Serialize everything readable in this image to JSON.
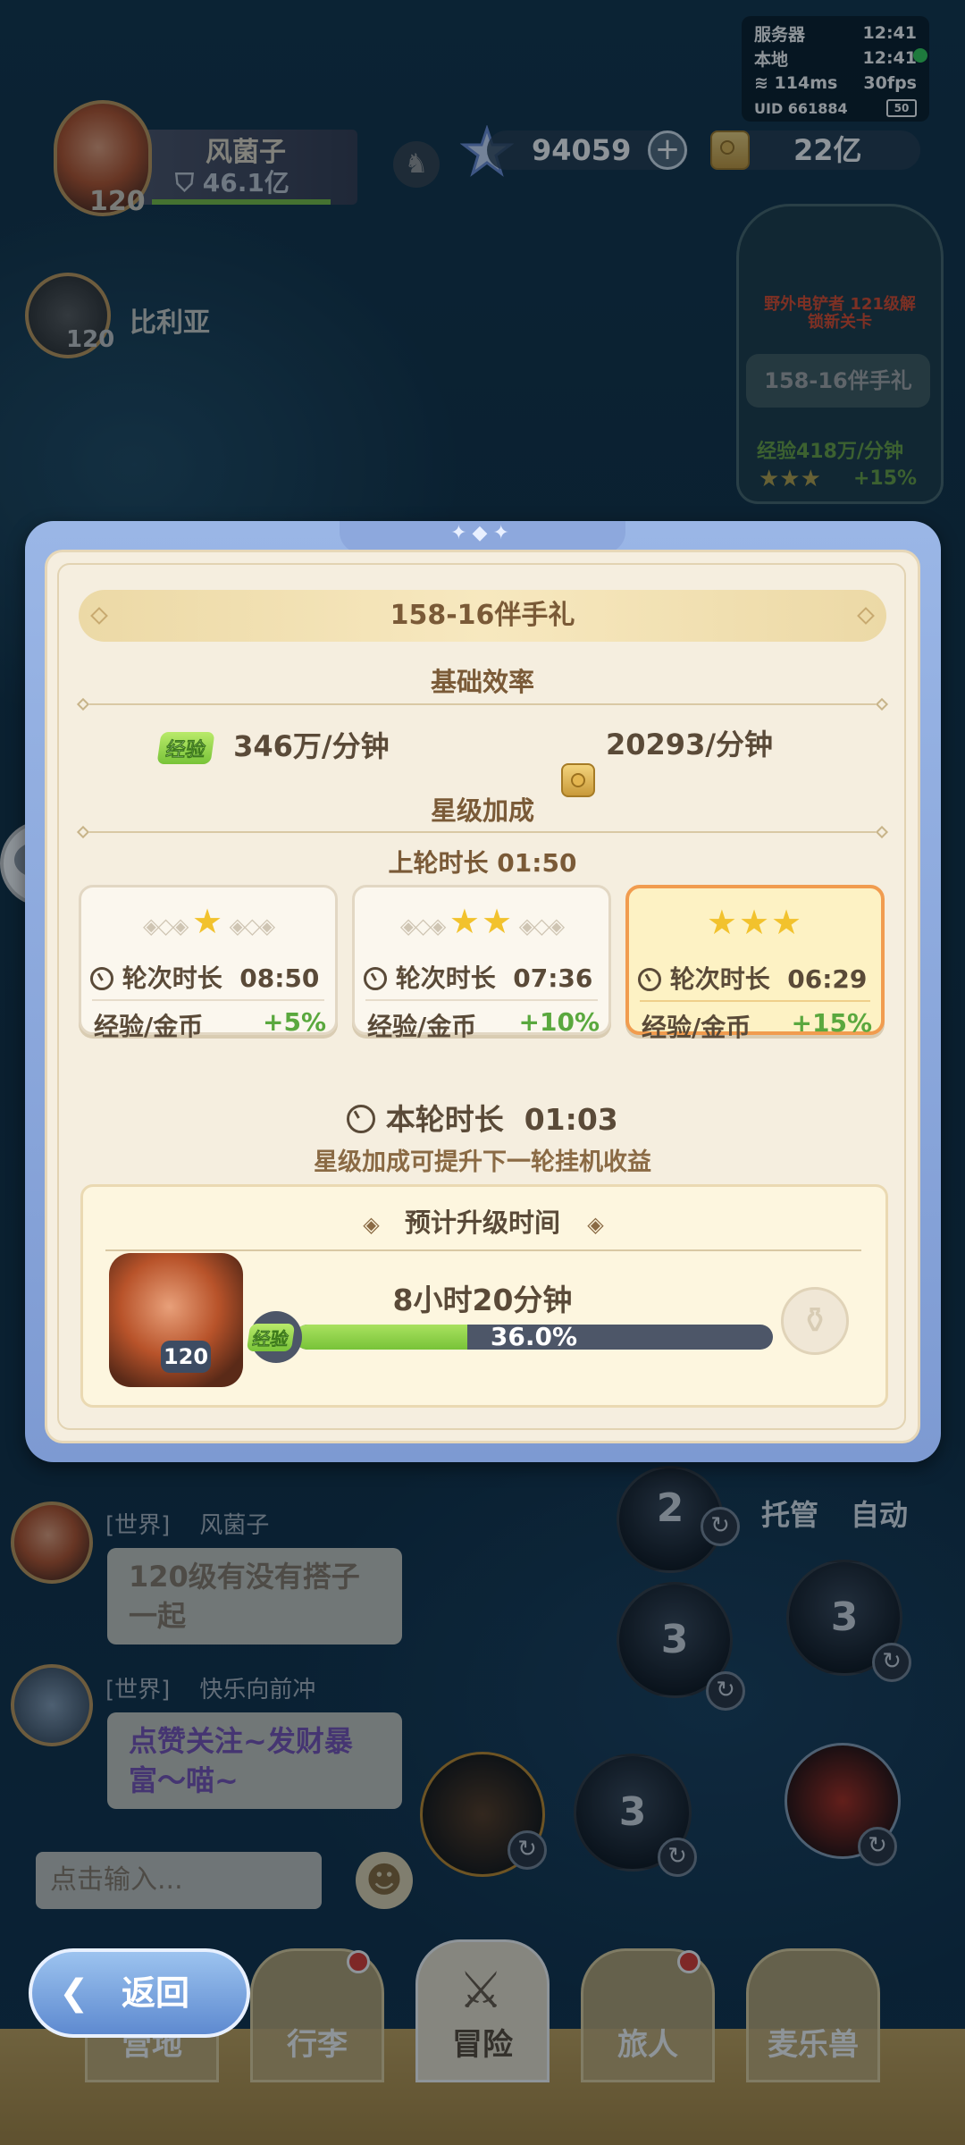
{
  "status": {
    "server_label": "服务器",
    "server_time": "12:41",
    "local_label": "本地",
    "local_time": "12:41",
    "ping": "114ms",
    "fps": "30fps",
    "uid": "UID 661884",
    "battery": "50"
  },
  "currency": {
    "gems": "94059",
    "gold": "22亿"
  },
  "player": {
    "name": "风菌子",
    "power": "46.1亿",
    "level": "120"
  },
  "companion": {
    "name": "比利亚",
    "level": "120"
  },
  "stage_card": {
    "promo_line1": "野外电铲者 121级解",
    "promo_line2": "锁新关卡",
    "stage_name": "158-16伴手礼",
    "exp_rate": "经验418万/分钟",
    "bonus": "+15%"
  },
  "modal": {
    "tab_deco": "✦◆✦",
    "title": "158-16伴手礼",
    "base_title": "基础效率",
    "exp_badge": "经验",
    "exp_rate": "346万/分钟",
    "gold_rate": "20293/分钟",
    "star_title": "星级加成",
    "last_round": "上轮时长  01:50",
    "cards": [
      {
        "stars": "★",
        "round_label": "轮次时长",
        "round_time": "08:50",
        "bonus_label": "经验/金币",
        "bonus": "+5%"
      },
      {
        "stars": "★★",
        "round_label": "轮次时长",
        "round_time": "07:36",
        "bonus_label": "经验/金币",
        "bonus": "+10%"
      },
      {
        "stars": "★★★",
        "round_label": "轮次时长",
        "round_time": "06:29",
        "bonus_label": "经验/金币",
        "bonus": "+15%"
      }
    ],
    "current_round_label": "本轮时长",
    "current_round_time": "01:03",
    "hint": "星级加成可提升下一轮挂机收益",
    "upgrade_title": "预计升级时间",
    "upgrade_time": "8小时20分钟",
    "hero_level": "120",
    "progress_badge": "经验",
    "progress_text": "36.0%",
    "progress_value": 0.36
  },
  "chat": {
    "msg1_channel": "[世界]",
    "msg1_name": "风菌子",
    "msg1_text_l1": "120级有没有搭子",
    "msg1_text_l2": "一起",
    "msg2_channel": "[世界]",
    "msg2_name": "快乐向前冲",
    "msg2_text_l1": "点赞关注~发财暴",
    "msg2_text_l2": "富～喵~",
    "input_placeholder": "点击输入..."
  },
  "side": {
    "auto_manage": "托管",
    "auto": "自动",
    "skill2": "2",
    "skill3a": "3",
    "skill3b": "3",
    "skill3c": "3"
  },
  "nav": {
    "back": "返回",
    "tabs": [
      "营地",
      "行李",
      "冒险",
      "旅人",
      "麦乐兽"
    ]
  }
}
